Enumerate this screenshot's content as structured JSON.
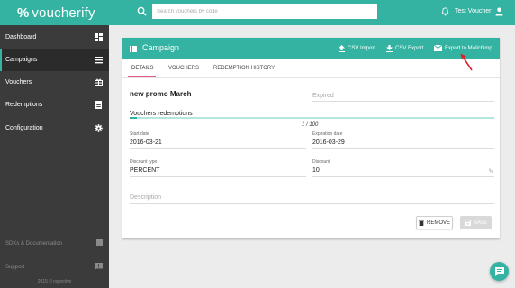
{
  "brand": {
    "mark": "%",
    "name": "voucherify"
  },
  "header": {
    "search_placeholder": "Search vouchers by code",
    "user_name": "Test Voucher"
  },
  "sidebar": {
    "items": [
      {
        "label": "Dashboard",
        "icon": "grid-icon"
      },
      {
        "label": "Campaigns",
        "icon": "list-icon"
      },
      {
        "label": "Vouchers",
        "icon": "gift-icon"
      },
      {
        "label": "Redemptions",
        "icon": "document-icon"
      },
      {
        "label": "Configuration",
        "icon": "gear-icon"
      }
    ],
    "footer_items": [
      {
        "label": "SDKs & Documentation",
        "icon": "library-icon"
      },
      {
        "label": "Support",
        "icon": "feedback-icon"
      }
    ],
    "copyright": "2015 © rspective"
  },
  "card": {
    "title": "Campaign",
    "actions": {
      "csv_import": "CSV Import",
      "csv_export": "CSV Export",
      "mailchimp": "Export to Mailchimp"
    },
    "tabs": [
      "DETAILS",
      "VOUCHERS",
      "REDEMPTION HISTORY"
    ],
    "active_tab": "DETAILS"
  },
  "voucher": {
    "name": "new promo March",
    "status": "Expired",
    "redemptions_label": "Vouchers redemptions",
    "redemptions_text": "1 / 100",
    "redeemed": 1,
    "redeem_limit": 100,
    "start_date_label": "Start date",
    "start_date": "2016-03-21",
    "expiration_date_label": "Expiration date",
    "expiration_date": "2016-03-29",
    "discount_type_label": "Discount type",
    "discount_type": "PERCENT",
    "discount_label": "Discount",
    "discount": "10",
    "discount_unit": "%",
    "description_placeholder": "Description"
  },
  "buttons": {
    "remove": "REMOVE",
    "save": "SAVE"
  },
  "colors": {
    "accent": "#35b3a2",
    "tab_indicator": "#e95e89",
    "sidebar": "#3b3b3b",
    "annotation": "#d7262d"
  }
}
